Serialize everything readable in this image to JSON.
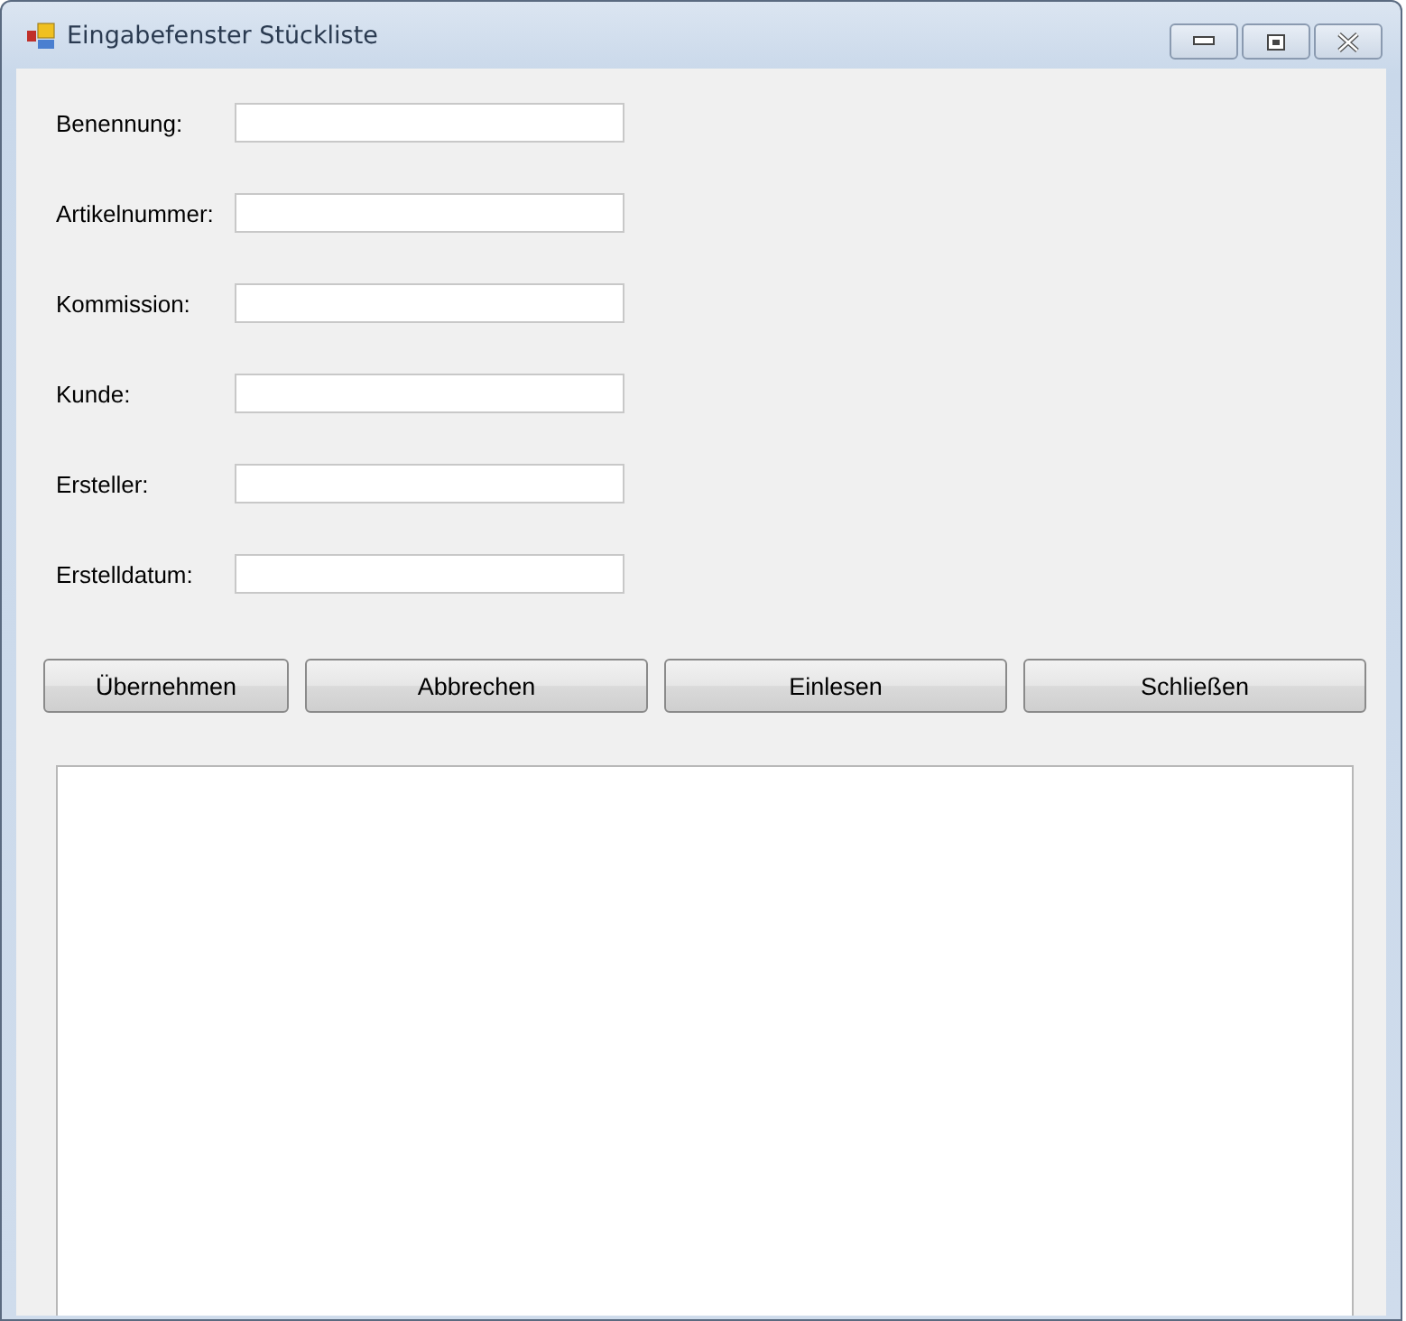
{
  "window": {
    "title": "Eingabefenster Stückliste"
  },
  "fields": [
    {
      "label": "Benennung:"
    },
    {
      "label": "Artikelnummer:"
    },
    {
      "label": "Kommission:"
    },
    {
      "label": "Kunde:"
    },
    {
      "label": "Ersteller:"
    },
    {
      "label": "Erstelldatum:"
    }
  ],
  "buttons": [
    "Übernehmen",
    "Abbrechen",
    "Einlesen",
    "Schließen"
  ]
}
